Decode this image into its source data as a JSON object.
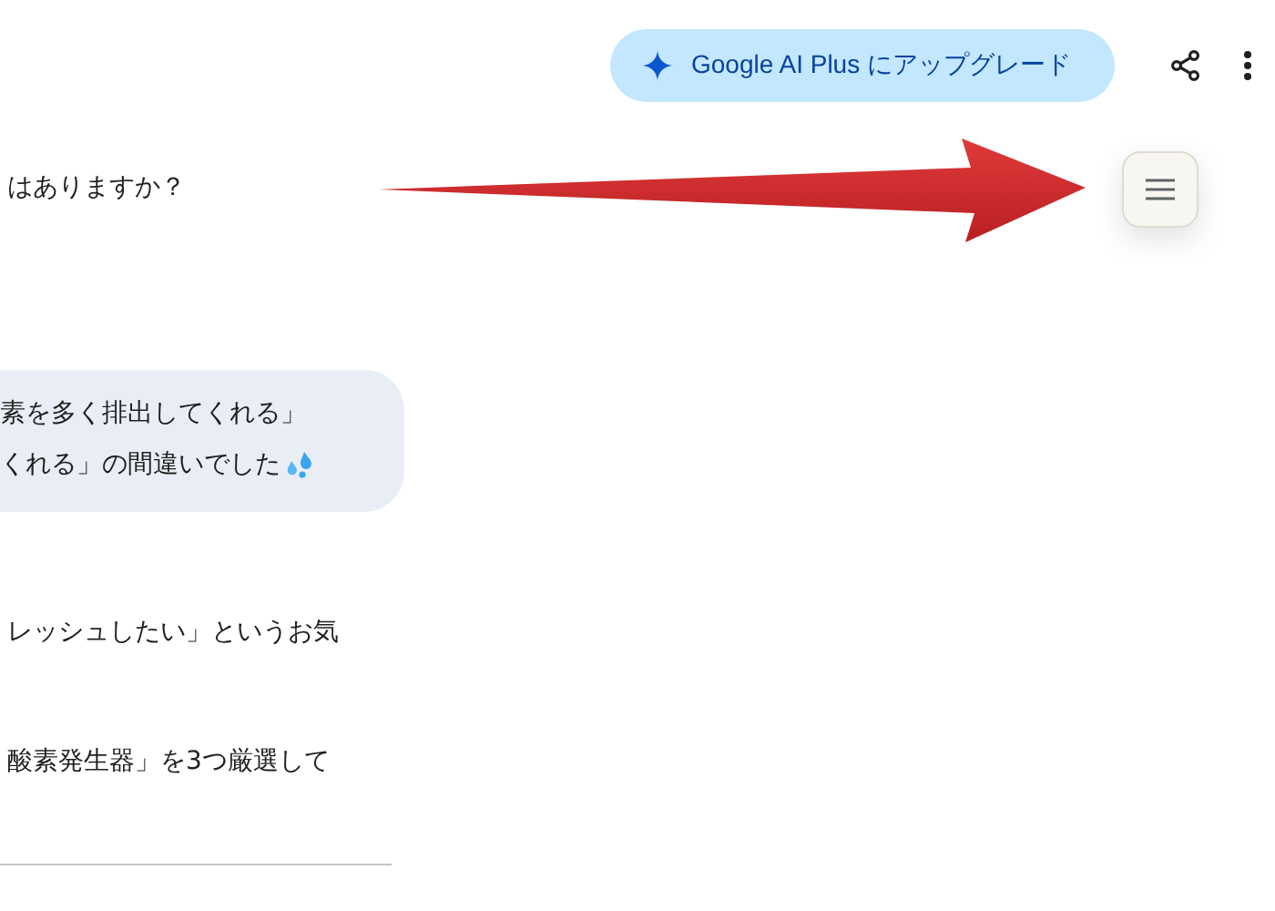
{
  "header": {
    "upgrade_button": "Google AI Plus にアップグレード"
  },
  "messages": [
    {
      "kind": "text",
      "lines": [
        "はありますか？"
      ]
    },
    {
      "kind": "bubble",
      "lines": [
        "素を多く排出してくれる」",
        "くれる」の間違いでした"
      ]
    },
    {
      "kind": "text",
      "lines": [
        "レッシュしたい」というお気"
      ]
    },
    {
      "kind": "text",
      "lines": [
        "酸素発生器」を3つ厳選して"
      ]
    }
  ]
}
